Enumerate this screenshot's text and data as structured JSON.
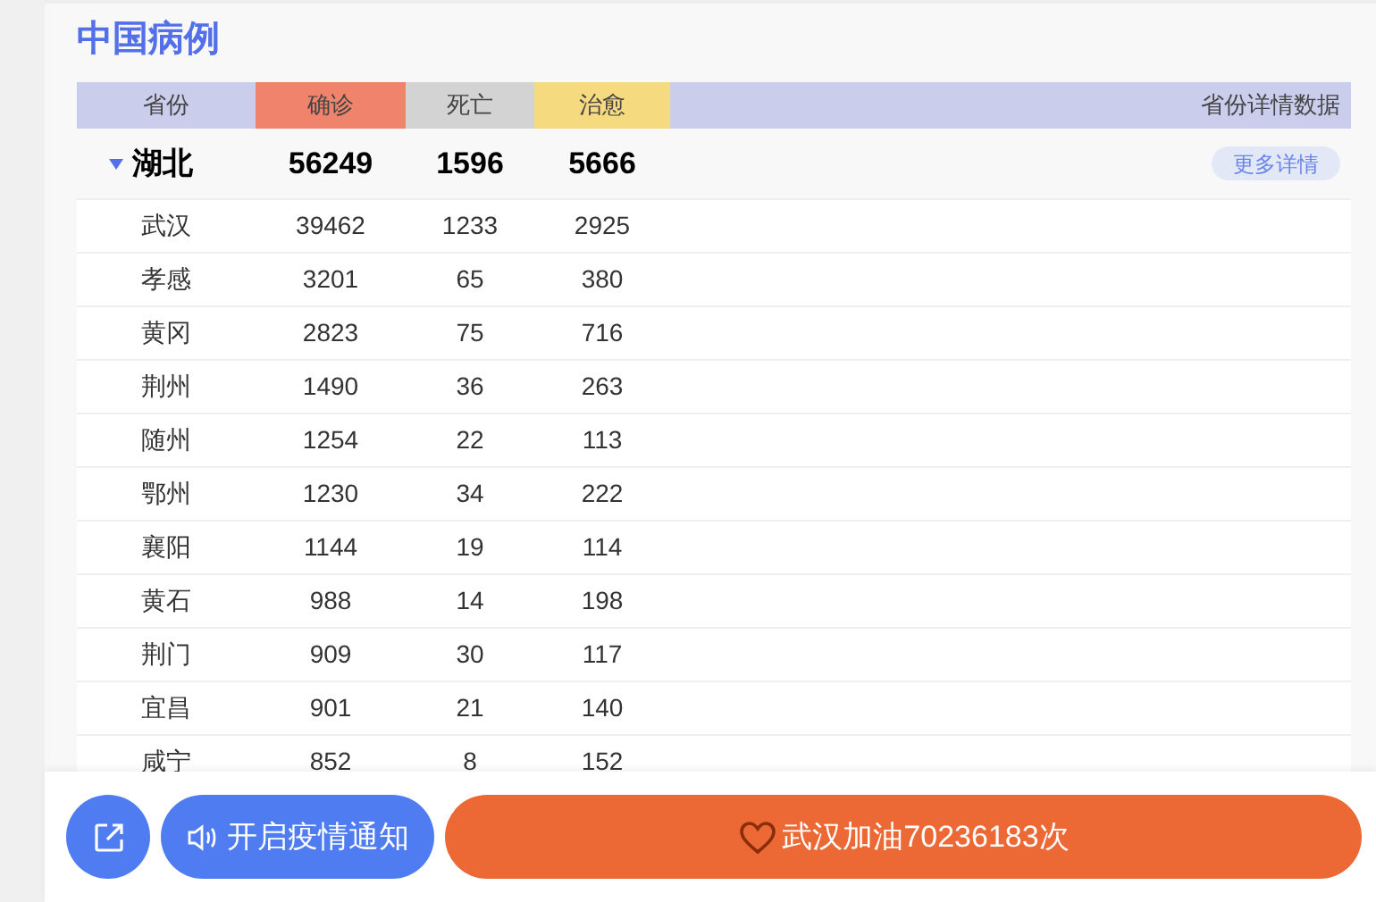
{
  "title": "中国病例",
  "columns": [
    {
      "label": "省份",
      "color": "#cbcdec"
    },
    {
      "label": "确诊",
      "color": "#f0836c"
    },
    {
      "label": "死亡",
      "color": "#d3d3d3"
    },
    {
      "label": "治愈",
      "color": "#f6da7f"
    },
    {
      "label": "省份详情数据",
      "color": "#cbcdec"
    }
  ],
  "province": {
    "name": "湖北",
    "expanded": true,
    "confirmed": "56249",
    "deaths": "1596",
    "cured": "5666",
    "more_button": "更多详情",
    "cities": [
      {
        "name": "武汉",
        "confirmed": "39462",
        "deaths": "1233",
        "cured": "2925"
      },
      {
        "name": "孝感",
        "confirmed": "3201",
        "deaths": "65",
        "cured": "380"
      },
      {
        "name": "黄冈",
        "confirmed": "2823",
        "deaths": "75",
        "cured": "716"
      },
      {
        "name": "荆州",
        "confirmed": "1490",
        "deaths": "36",
        "cured": "263"
      },
      {
        "name": "随州",
        "confirmed": "1254",
        "deaths": "22",
        "cured": "113"
      },
      {
        "name": "鄂州",
        "confirmed": "1230",
        "deaths": "34",
        "cured": "222"
      },
      {
        "name": "襄阳",
        "confirmed": "1144",
        "deaths": "19",
        "cured": "114"
      },
      {
        "name": "黄石",
        "confirmed": "988",
        "deaths": "14",
        "cured": "198"
      },
      {
        "name": "荆门",
        "confirmed": "909",
        "deaths": "30",
        "cured": "117"
      },
      {
        "name": "宜昌",
        "confirmed": "901",
        "deaths": "21",
        "cured": "140"
      },
      {
        "name": "咸宁",
        "confirmed": "852",
        "deaths": "8",
        "cured": "152"
      }
    ]
  },
  "bottom_bar": {
    "notify_button": "开启疫情通知",
    "cheer_button": "武汉加油70236183次"
  }
}
